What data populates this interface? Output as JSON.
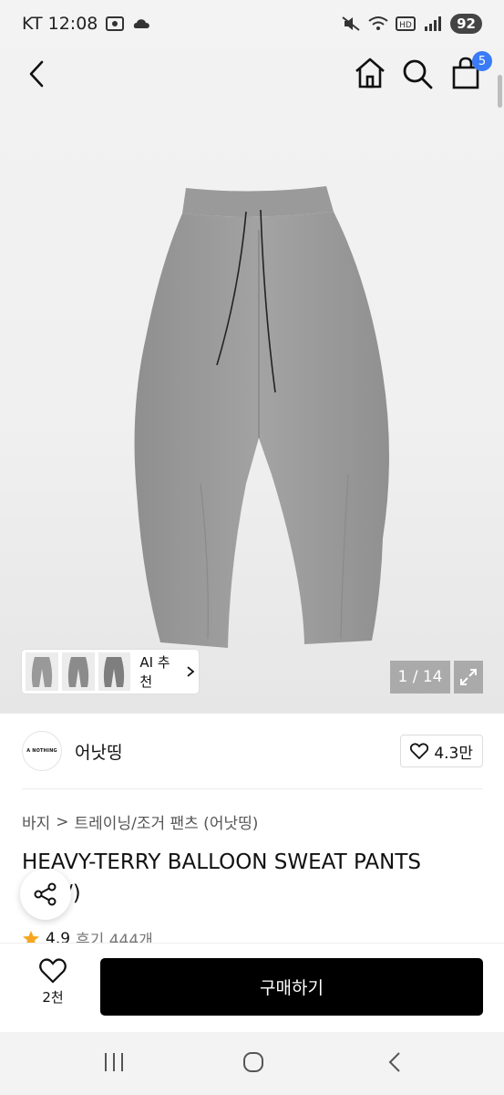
{
  "status_bar": {
    "carrier_time": "KT 12:08",
    "battery": "92",
    "icons": [
      "screenshot-icon",
      "cloud-icon",
      "mute-icon",
      "wifi-icon",
      "hd-icon",
      "signal-icon"
    ]
  },
  "header": {
    "icons": [
      "back-arrow-icon",
      "home-icon",
      "search-icon",
      "shopping-bag-icon"
    ],
    "cart_count": "5"
  },
  "gallery": {
    "counter": "1 / 14",
    "ai_recommend_label": "AI 추천",
    "thumbnail_count": 3,
    "product_color": "#9a9a9a"
  },
  "brand": {
    "logo_text": "A NOTHING",
    "name": "어낫띵",
    "likes": "4.3만"
  },
  "breadcrumb": {
    "level1": "바지",
    "separator": ">",
    "level2": "트레이닝/조거 팬츠 (어낫띵)"
  },
  "product": {
    "title": "HEAVY-TERRY BALLOON SWEAT PANTS",
    "title_line2": "/)"
  },
  "rating": {
    "score": "4.9",
    "review_label": "후기 444개",
    "star_color": "#f5a623"
  },
  "purchase": {
    "wish_count": "2천",
    "buy_label": "구매하기"
  },
  "colors": {
    "accent_badge": "#3a7bf6",
    "buy_button": "#000000"
  }
}
